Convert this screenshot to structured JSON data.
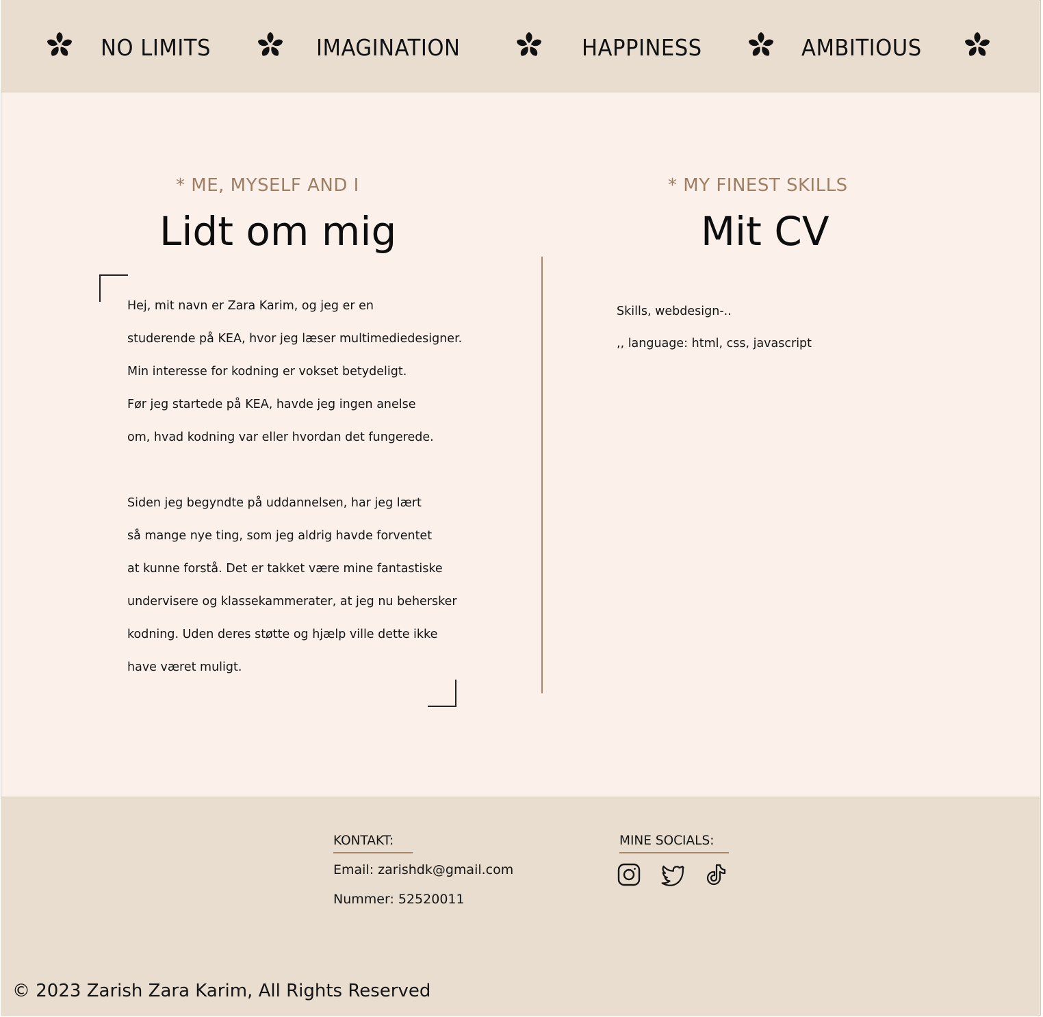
{
  "marquee": {
    "words": [
      "NO LIMITS",
      "IMAGINATION",
      "HAPPINESS",
      "AMBITIOUS"
    ]
  },
  "about": {
    "eyebrow": "* ME, MYSELF AND I",
    "title": "Lidt om mig",
    "lines": [
      "Hej, mit navn er Zara Karim, og jeg er en",
      "studerende på KEA, hvor jeg læser multimediedesigner.",
      "Min interesse for kodning er vokset betydeligt.",
      "Før jeg startede på KEA, havde jeg ingen anelse",
      "om, hvad kodning var eller hvordan det fungerede.",
      "Siden jeg begyndte på uddannelsen, har jeg lært",
      "så mange nye ting, som jeg aldrig havde forventet",
      "at kunne forstå. Det er takket være mine fantastiske",
      "undervisere og klassekammerater, at jeg nu behersker",
      "kodning. Uden deres støtte og hjælp ville dette ikke",
      "have været muligt."
    ]
  },
  "cv": {
    "eyebrow": "* MY FINEST SKILLS",
    "title": "Mit CV",
    "lines": [
      "Skills, webdesign-..",
      ",, language: html, css, javascript"
    ]
  },
  "footer": {
    "contact_heading": "KONTAKT:",
    "email": "Email: zarishdk@gmail.com",
    "phone": "Nummer: 52520011",
    "socials_heading": "MINE SOCIALS:",
    "socials": [
      "instagram-icon",
      "twitter-icon",
      "tiktok-icon"
    ],
    "copyright": "© 2023 Zarish Zara Karim, All Rights Reserved"
  },
  "colors": {
    "band": "#e8ddcf",
    "page": "#fbf1ea",
    "accent": "#a88469",
    "eyebrow": "#9e7e64"
  }
}
